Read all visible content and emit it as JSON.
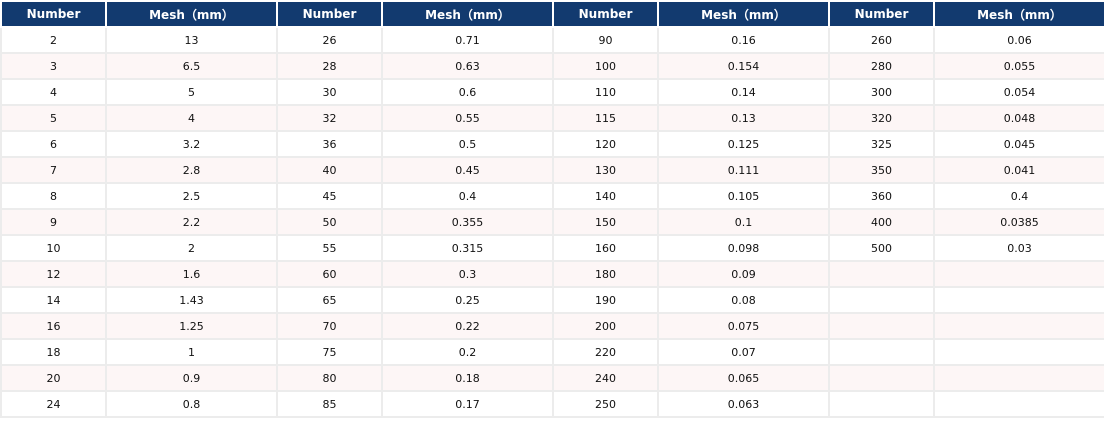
{
  "headers": [
    "Number",
    "Mesh（mm）",
    "Number",
    "Mesh（mm）",
    "Number",
    "Mesh（mm）",
    "Number",
    "Mesh（mm）"
  ],
  "rows": [
    [
      "2",
      "13",
      "26",
      "0.71",
      "90",
      "0.16",
      "260",
      "0.06"
    ],
    [
      "3",
      "6.5",
      "28",
      "0.63",
      "100",
      "0.154",
      "280",
      "0.055"
    ],
    [
      "4",
      "5",
      "30",
      "0.6",
      "110",
      "0.14",
      "300",
      "0.054"
    ],
    [
      "5",
      "4",
      "32",
      "0.55",
      "115",
      "0.13",
      "320",
      "0.048"
    ],
    [
      "6",
      "3.2",
      "36",
      "0.5",
      "120",
      "0.125",
      "325",
      "0.045"
    ],
    [
      "7",
      "2.8",
      "40",
      "0.45",
      "130",
      "0.111",
      "350",
      "0.041"
    ],
    [
      "8",
      "2.5",
      "45",
      "0.4",
      "140",
      "0.105",
      "360",
      "0.4"
    ],
    [
      "9",
      "2.2",
      "50",
      "0.355",
      "150",
      "0.1",
      "400",
      "0.0385"
    ],
    [
      "10",
      "2",
      "55",
      "0.315",
      "160",
      "0.098",
      "500",
      "0.03"
    ],
    [
      "12",
      "1.6",
      "60",
      "0.3",
      "180",
      "0.09",
      "",
      ""
    ],
    [
      "14",
      "1.43",
      "65",
      "0.25",
      "190",
      "0.08",
      "",
      ""
    ],
    [
      "16",
      "1.25",
      "70",
      "0.22",
      "200",
      "0.075",
      "",
      ""
    ],
    [
      "18",
      "1",
      "75",
      "0.2",
      "220",
      "0.07",
      "",
      ""
    ],
    [
      "20",
      "0.9",
      "80",
      "0.18",
      "240",
      "0.065",
      "",
      ""
    ],
    [
      "24",
      "0.8",
      "85",
      "0.17",
      "250",
      "0.063",
      "",
      ""
    ]
  ],
  "colors": {
    "header_bg": "#123a6f",
    "header_text": "#ffffff",
    "alt_row_bg": "#fdf6f6",
    "grid_line": "#ececec"
  }
}
